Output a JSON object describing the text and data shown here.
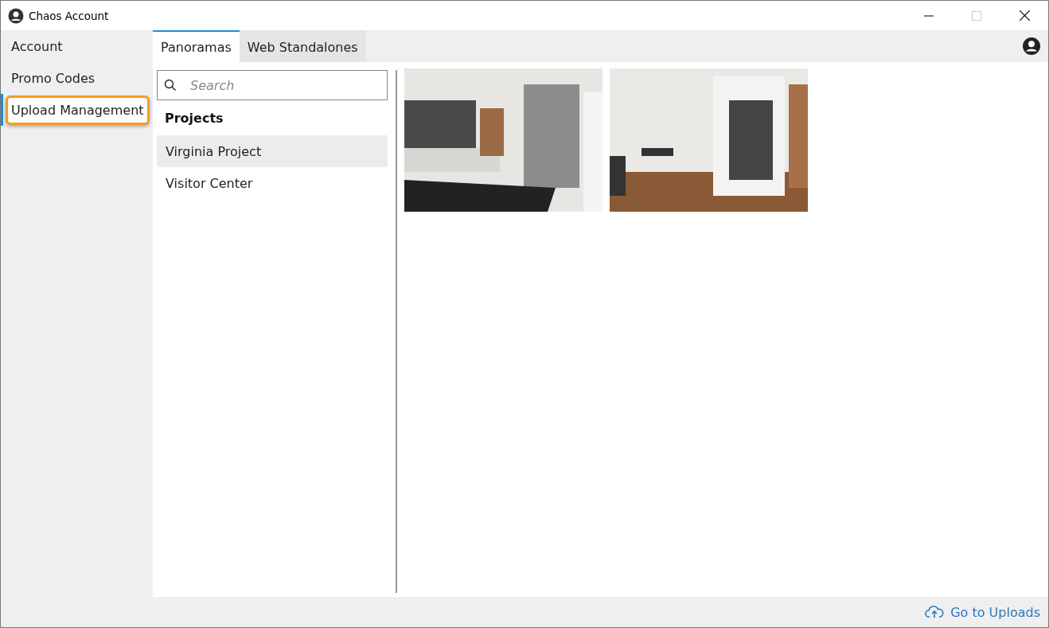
{
  "window": {
    "title": "Chaos Account"
  },
  "sidebar": {
    "items": [
      {
        "label": "Account",
        "selected": false,
        "highlighted": false
      },
      {
        "label": "Promo Codes",
        "selected": false,
        "highlighted": false
      },
      {
        "label": "Upload Management",
        "selected": true,
        "highlighted": true
      }
    ]
  },
  "tabs": [
    {
      "label": "Panoramas",
      "selected": true
    },
    {
      "label": "Web Standalones",
      "selected": false
    }
  ],
  "search": {
    "placeholder": "Search"
  },
  "projects": {
    "heading": "Projects",
    "items": [
      {
        "label": "Virginia Project",
        "selected": true
      },
      {
        "label": "Visitor Center",
        "selected": false
      }
    ]
  },
  "panoramas": [
    {
      "kind": "kitchen"
    },
    {
      "kind": "dining"
    }
  ],
  "footer": {
    "link": "Go to Uploads"
  }
}
